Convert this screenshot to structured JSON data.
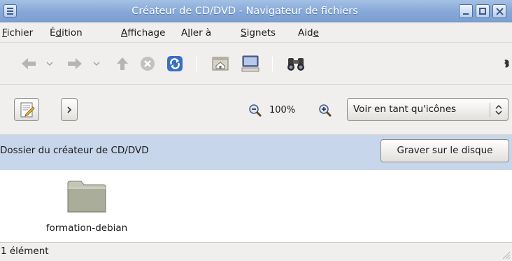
{
  "window": {
    "title": "Créateur de CD/DVD - Navigateur de fichiers"
  },
  "menubar": {
    "items": [
      {
        "label": "Fichier",
        "accel": "F"
      },
      {
        "label": "Édition",
        "accel": "d"
      },
      {
        "label": "Affichage",
        "accel": "A"
      },
      {
        "label": "Aller à",
        "accel": "l"
      },
      {
        "label": "Signets",
        "accel": "S"
      },
      {
        "label": "Aide",
        "accel": "e"
      }
    ]
  },
  "toolbar": {
    "icons": [
      "back-arrow-icon",
      "back-dropdown-icon",
      "forward-arrow-icon",
      "forward-dropdown-icon",
      "up-arrow-icon",
      "stop-icon",
      "reload-icon",
      "home-icon",
      "computer-icon",
      "search-binoculars-icon",
      "throbber-icon"
    ]
  },
  "location": {
    "zoom_value": "100%",
    "view_mode": "Voir en tant qu'icônes"
  },
  "infobar": {
    "text": "Dossier du créateur de CD/DVD",
    "burn_button": "Graver sur le disque"
  },
  "files": [
    {
      "name": "formation-debian",
      "icon": "folder-icon"
    }
  ],
  "status": {
    "text": "1 élément"
  },
  "colors": {
    "titlebar": "#86a8d8",
    "infobar": "#c7d6ea",
    "chrome": "#f0efed"
  }
}
